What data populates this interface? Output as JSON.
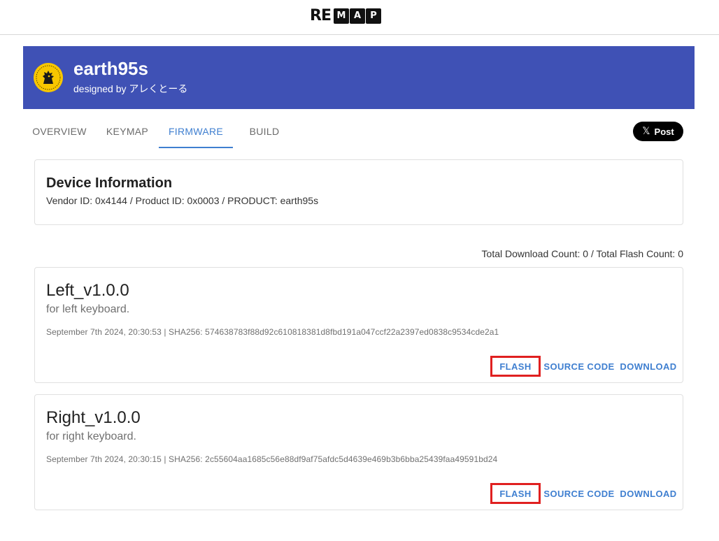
{
  "logo": {
    "re": "RE",
    "boxes": [
      "M",
      "A",
      "P"
    ]
  },
  "keyboard": {
    "name": "earth95s",
    "designed_by": "designed by アレくとーる"
  },
  "tabs": [
    {
      "label": "OVERVIEW",
      "active": false
    },
    {
      "label": "KEYMAP",
      "active": false
    },
    {
      "label": "FIRMWARE",
      "active": true
    },
    {
      "label": "BUILD",
      "active": false
    }
  ],
  "post_button": {
    "label": "Post",
    "icon": "x-logo-icon"
  },
  "device": {
    "title": "Device Information",
    "info": "Vendor ID: 0x4144 / Product ID: 0x0003 / PRODUCT: earth95s"
  },
  "totals": "Total Download Count: 0 / Total Flash Count: 0",
  "firmwares": [
    {
      "name": "Left_v1.0.0",
      "description": "for left keyboard.",
      "meta": "September 7th 2024, 20:30:53 | SHA256: 574638783f88d92c610818381d8fbd191a047ccf22a2397ed0838c9534cde2a1",
      "actions": {
        "flash": "FLASH",
        "source": "SOURCE CODE",
        "download": "DOWNLOAD"
      }
    },
    {
      "name": "Right_v1.0.0",
      "description": "for right keyboard.",
      "meta": "September 7th 2024, 20:30:15 | SHA256: 2c55604aa1685c56e88df9af75afdc5d4639e469b3b6bba25439faa49591bd24",
      "actions": {
        "flash": "FLASH",
        "source": "SOURCE CODE",
        "download": "DOWNLOAD"
      }
    }
  ],
  "colors": {
    "banner": "#3f51b5",
    "accent": "#3f7fd0",
    "highlight": "#e02020"
  }
}
